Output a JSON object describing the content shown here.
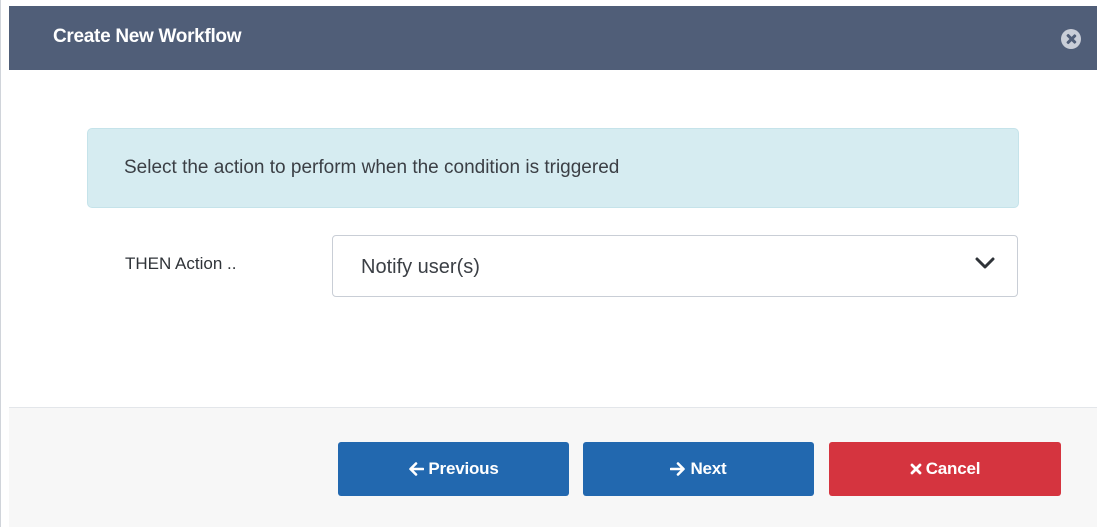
{
  "dialog": {
    "title": "Create New Workflow"
  },
  "info": {
    "message": "Select the action to perform when the condition is triggered"
  },
  "form": {
    "then_action_label": "THEN Action ..",
    "then_action_value": "Notify user(s)"
  },
  "buttons": {
    "previous_label": "Previous",
    "next_label": "Next",
    "cancel_label": "Cancel"
  },
  "icons": {
    "close": "close-circle-icon",
    "chevron": "chevron-down-icon",
    "previous": "arrow-left-icon",
    "next": "arrow-right-icon",
    "cancel": "x-icon"
  },
  "colors": {
    "titlebar": "#505e78",
    "info_background": "#d6ecf1",
    "primary_button": "#2268af",
    "danger_button": "#d5343f",
    "footer_background": "#f7f7f7"
  }
}
